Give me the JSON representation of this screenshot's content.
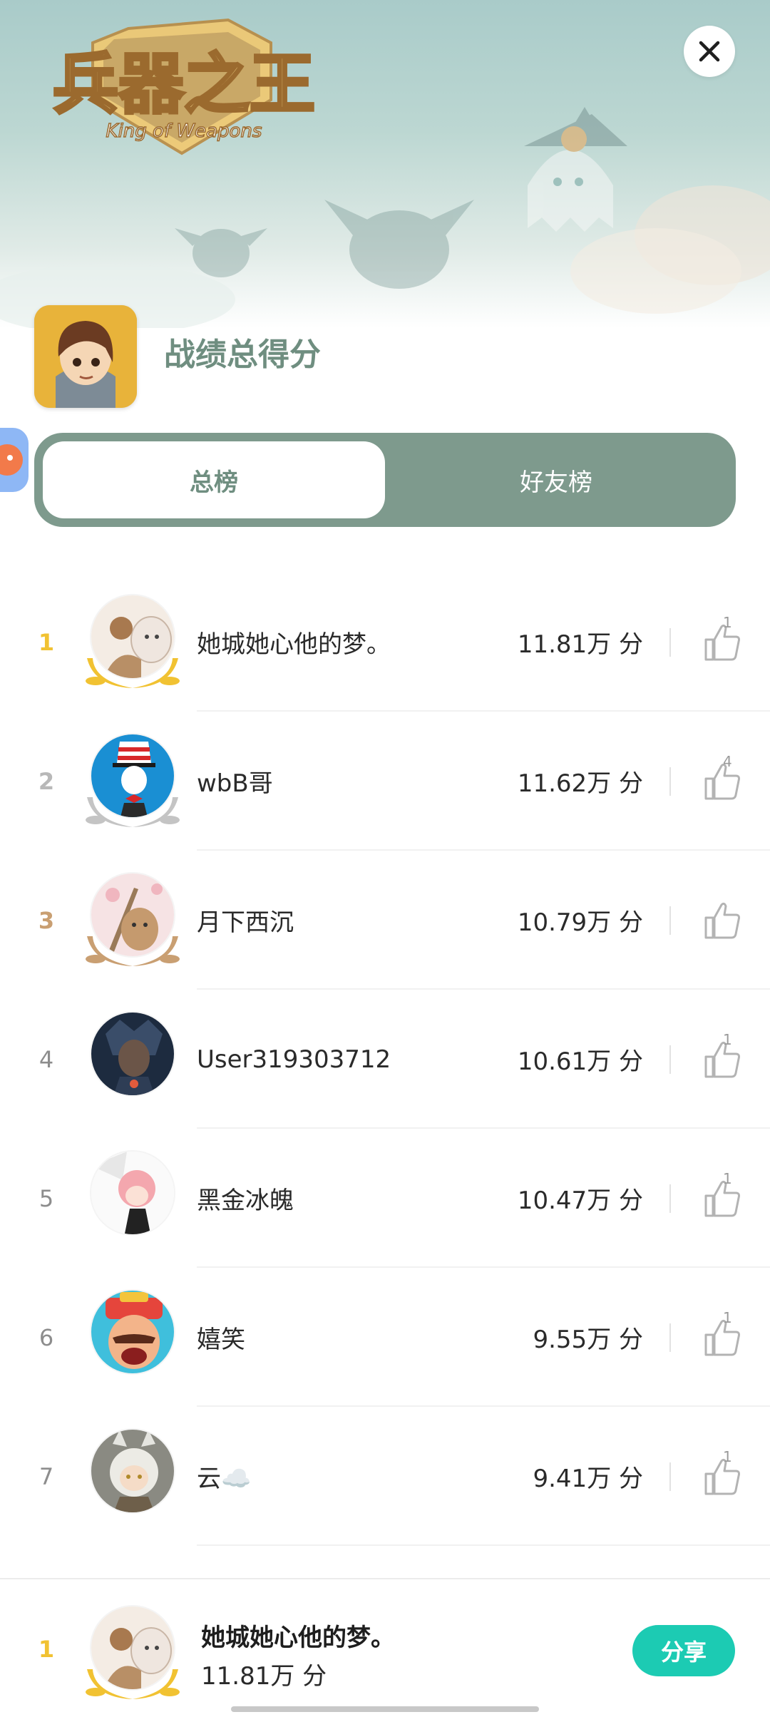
{
  "header": {
    "logo_text": "兵器之王",
    "logo_subtitle": "King of Weapons",
    "close_icon": "close-icon"
  },
  "section": {
    "title": "战绩总得分"
  },
  "tabs": [
    {
      "label": "总榜",
      "active": true
    },
    {
      "label": "好友榜",
      "active": false
    }
  ],
  "unit_suffix": "分",
  "leaderboard": [
    {
      "rank": "1",
      "name": "她城她心他的梦。",
      "score": "11.81万 分",
      "likes": "1",
      "medal": "gold"
    },
    {
      "rank": "2",
      "name": "wbB哥",
      "score": "11.62万 分",
      "likes": "4",
      "medal": "silver"
    },
    {
      "rank": "3",
      "name": "月下西沉",
      "score": "10.79万 分",
      "likes": "",
      "medal": "bronze"
    },
    {
      "rank": "4",
      "name": "User319303712",
      "score": "10.61万 分",
      "likes": "1",
      "medal": ""
    },
    {
      "rank": "5",
      "name": "黑金冰魄",
      "score": "10.47万 分",
      "likes": "1",
      "medal": ""
    },
    {
      "rank": "6",
      "name": "嬉笑",
      "score": "9.55万 分",
      "likes": "1",
      "medal": ""
    },
    {
      "rank": "7",
      "name": "云☁️",
      "score": "9.41万 分",
      "likes": "1",
      "medal": ""
    }
  ],
  "me": {
    "rank": "1",
    "name": "她城她心他的梦。",
    "score": "11.81万 分"
  },
  "share_label": "分享",
  "colors": {
    "accent_green": "#7e9a8d",
    "title_green": "#6f8e80",
    "share_teal": "#1ccbb3",
    "gold": "#f1c232",
    "silver": "#b8b8b8",
    "bronze": "#c99f72"
  }
}
